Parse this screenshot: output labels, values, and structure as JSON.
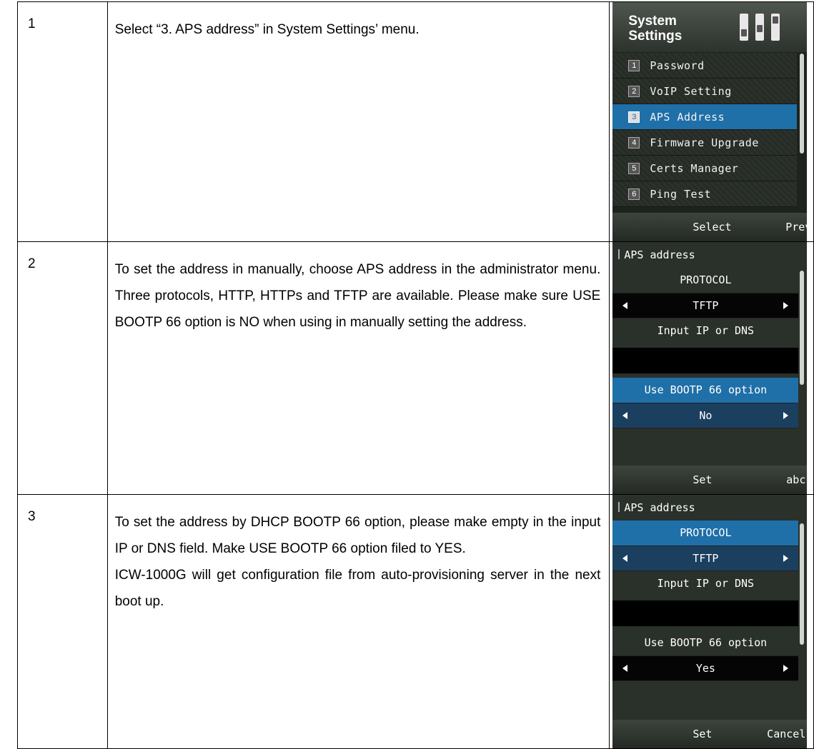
{
  "rows": [
    {
      "number": "1",
      "text": [
        "Select “3. APS address” in System Settings’ menu."
      ],
      "screen": {
        "title": "System Settings",
        "icon": "sliders-icon",
        "items": [
          {
            "num": "1",
            "label": "Password",
            "selected": false
          },
          {
            "num": "2",
            "label": "VoIP Setting",
            "selected": false
          },
          {
            "num": "3",
            "label": "APS Address",
            "selected": true
          },
          {
            "num": "4",
            "label": "Firmware Upgrade",
            "selected": false
          },
          {
            "num": "5",
            "label": "Certs Manager",
            "selected": false
          },
          {
            "num": "6",
            "label": "Ping Test",
            "selected": false
          }
        ],
        "softkey_left": "Select",
        "softkey_right": "Prev"
      }
    },
    {
      "number": "2",
      "text": [
        "To set the address in manually, choose APS address in the administrator menu. Three protocols, HTTP, HTTPs and TFTP are available. Please make sure USE BOOTP 66 option is NO when using in manually setting the address."
      ],
      "screen": {
        "title": "APS address",
        "protocol_label": "PROTOCOL",
        "protocol_value": "TFTP",
        "input_label": "Input IP or DNS",
        "input_value": "",
        "bootp_label": "Use BOOTP 66 option",
        "bootp_value": "No",
        "softkey_left": "Set",
        "softkey_right": "abc"
      }
    },
    {
      "number": "3",
      "text": [
        "To set the address by DHCP BOOTP  66 option, please make empty in the input IP or DNS field. Make USE BOOTP 66 option filed to YES.",
        "ICW-1000G will get configuration file from auto-provisioning server in the next boot up."
      ],
      "screen": {
        "title": "APS address",
        "protocol_label": "PROTOCOL",
        "protocol_value": "TFTP",
        "input_label": "Input IP or DNS",
        "input_value": "",
        "bootp_label": "Use BOOTP 66 option",
        "bootp_value": "Yes",
        "softkey_left": "Set",
        "softkey_right": "Cancel"
      }
    }
  ],
  "colors": {
    "highlight": "#1f6fa8",
    "screen_bg": "#2a302a",
    "softkey_bg": "#2f352f"
  }
}
